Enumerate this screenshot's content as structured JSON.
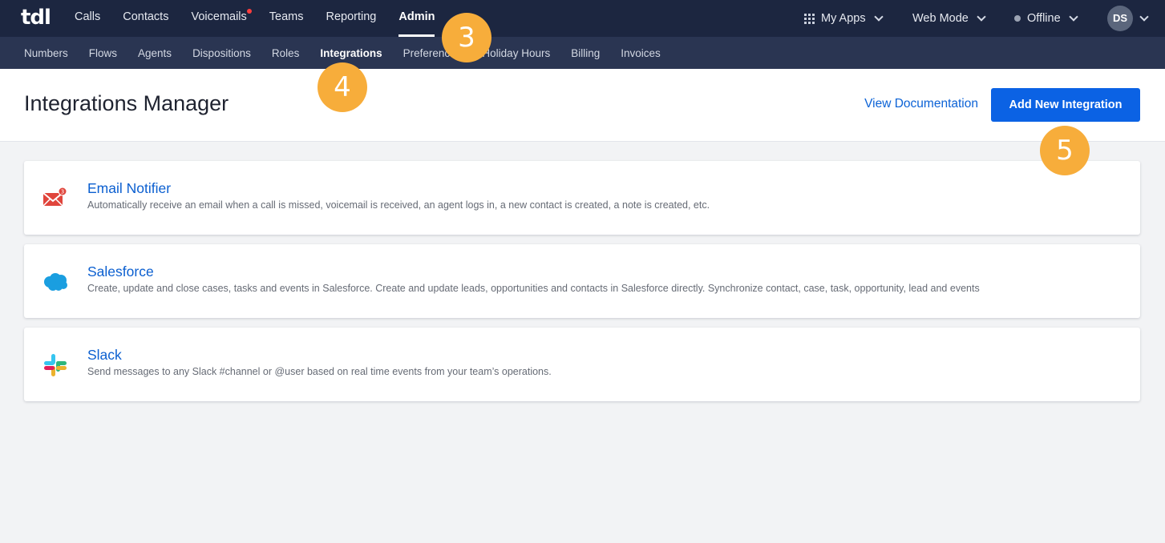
{
  "logo": {
    "text": "tdl"
  },
  "main_nav": [
    {
      "label": "Calls"
    },
    {
      "label": "Contacts"
    },
    {
      "label": "Voicemails"
    },
    {
      "label": "Teams"
    },
    {
      "label": "Reporting"
    },
    {
      "label": "Admin"
    }
  ],
  "right_nav": {
    "apps_label": "My Apps",
    "mode_label": "Web Mode",
    "status_label": "Offline",
    "avatar_initials": "DS"
  },
  "sub_nav": [
    {
      "label": "Numbers"
    },
    {
      "label": "Flows"
    },
    {
      "label": "Agents"
    },
    {
      "label": "Dispositions"
    },
    {
      "label": "Roles"
    },
    {
      "label": "Integrations"
    },
    {
      "label": "Preferences"
    },
    {
      "label": "Holiday Hours"
    },
    {
      "label": "Billing"
    },
    {
      "label": "Invoices"
    }
  ],
  "header": {
    "title": "Integrations Manager",
    "doc_link": "View Documentation",
    "add_button": "Add New Integration"
  },
  "integrations": [
    {
      "name": "Email Notifier",
      "icon": "email-icon",
      "description": "Automatically receive an email when a call is missed, voicemail is received, an agent logs in, a new contact is created, a note is created, etc."
    },
    {
      "name": "Salesforce",
      "icon": "salesforce-cloud-icon",
      "description": "Create, update and close cases, tasks and events in Salesforce. Create and update leads, opportunities and contacts in Salesforce directly. Synchronize contact, case, task, opportunity, lead and events"
    },
    {
      "name": "Slack",
      "icon": "slack-icon",
      "description": "Send messages to any Slack #channel or @user based on real time events from your team’s operations."
    }
  ],
  "steps": {
    "three": "3",
    "four": "4",
    "five": "5"
  },
  "colors": {
    "topnav": "#1c2640",
    "subnav": "#2a3552",
    "accent": "#0b62e4",
    "step": "#f7ad3b"
  }
}
